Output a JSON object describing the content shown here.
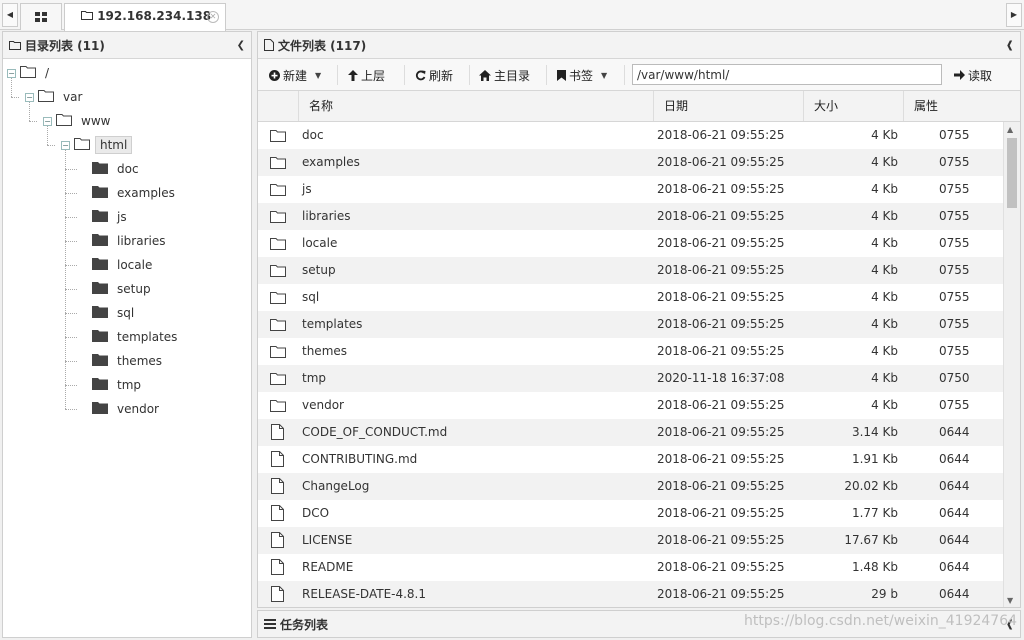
{
  "tabs": {
    "active_label": "192.168.234.138"
  },
  "dir_panel": {
    "title": "目录列表 (11)",
    "tree": [
      {
        "label": "/",
        "level": 0,
        "kind": "expanded"
      },
      {
        "label": "var",
        "level": 1,
        "kind": "expanded"
      },
      {
        "label": "www",
        "level": 2,
        "kind": "expanded"
      },
      {
        "label": "html",
        "level": 3,
        "kind": "expanded",
        "selected": true
      },
      {
        "label": "doc",
        "level": 4,
        "kind": "leaf"
      },
      {
        "label": "examples",
        "level": 4,
        "kind": "leaf"
      },
      {
        "label": "js",
        "level": 4,
        "kind": "leaf"
      },
      {
        "label": "libraries",
        "level": 4,
        "kind": "leaf"
      },
      {
        "label": "locale",
        "level": 4,
        "kind": "leaf"
      },
      {
        "label": "setup",
        "level": 4,
        "kind": "leaf"
      },
      {
        "label": "sql",
        "level": 4,
        "kind": "leaf"
      },
      {
        "label": "templates",
        "level": 4,
        "kind": "leaf"
      },
      {
        "label": "themes",
        "level": 4,
        "kind": "leaf"
      },
      {
        "label": "tmp",
        "level": 4,
        "kind": "leaf"
      },
      {
        "label": "vendor",
        "level": 4,
        "kind": "leaf"
      }
    ]
  },
  "file_panel": {
    "title": "文件列表 (117)",
    "toolbar": {
      "new_label": "新建",
      "up_label": "上层",
      "refresh_label": "刷新",
      "home_label": "主目录",
      "bookmark_label": "书签",
      "path_value": "/var/www/html/",
      "read_label": "读取"
    },
    "columns": {
      "name": "名称",
      "date": "日期",
      "size": "大小",
      "attr": "属性"
    },
    "rows": [
      {
        "type": "folder",
        "name": "doc",
        "date": "2018-06-21 09:55:25",
        "size": "4 Kb",
        "attr": "0755"
      },
      {
        "type": "folder",
        "name": "examples",
        "date": "2018-06-21 09:55:25",
        "size": "4 Kb",
        "attr": "0755"
      },
      {
        "type": "folder",
        "name": "js",
        "date": "2018-06-21 09:55:25",
        "size": "4 Kb",
        "attr": "0755"
      },
      {
        "type": "folder",
        "name": "libraries",
        "date": "2018-06-21 09:55:25",
        "size": "4 Kb",
        "attr": "0755"
      },
      {
        "type": "folder",
        "name": "locale",
        "date": "2018-06-21 09:55:25",
        "size": "4 Kb",
        "attr": "0755"
      },
      {
        "type": "folder",
        "name": "setup",
        "date": "2018-06-21 09:55:25",
        "size": "4 Kb",
        "attr": "0755"
      },
      {
        "type": "folder",
        "name": "sql",
        "date": "2018-06-21 09:55:25",
        "size": "4 Kb",
        "attr": "0755"
      },
      {
        "type": "folder",
        "name": "templates",
        "date": "2018-06-21 09:55:25",
        "size": "4 Kb",
        "attr": "0755"
      },
      {
        "type": "folder",
        "name": "themes",
        "date": "2018-06-21 09:55:25",
        "size": "4 Kb",
        "attr": "0755"
      },
      {
        "type": "folder",
        "name": "tmp",
        "date": "2020-11-18 16:37:08",
        "size": "4 Kb",
        "attr": "0750"
      },
      {
        "type": "folder",
        "name": "vendor",
        "date": "2018-06-21 09:55:25",
        "size": "4 Kb",
        "attr": "0755"
      },
      {
        "type": "file",
        "name": "CODE_OF_CONDUCT.md",
        "date": "2018-06-21 09:55:25",
        "size": "3.14 Kb",
        "attr": "0644"
      },
      {
        "type": "file",
        "name": "CONTRIBUTING.md",
        "date": "2018-06-21 09:55:25",
        "size": "1.91 Kb",
        "attr": "0644"
      },
      {
        "type": "file",
        "name": "ChangeLog",
        "date": "2018-06-21 09:55:25",
        "size": "20.02 Kb",
        "attr": "0644"
      },
      {
        "type": "file",
        "name": "DCO",
        "date": "2018-06-21 09:55:25",
        "size": "1.77 Kb",
        "attr": "0644"
      },
      {
        "type": "file",
        "name": "LICENSE",
        "date": "2018-06-21 09:55:25",
        "size": "17.67 Kb",
        "attr": "0644"
      },
      {
        "type": "file",
        "name": "README",
        "date": "2018-06-21 09:55:25",
        "size": "1.48 Kb",
        "attr": "0644"
      },
      {
        "type": "file",
        "name": "RELEASE-DATE-4.8.1",
        "date": "2018-06-21 09:55:25",
        "size": "29 b",
        "attr": "0644"
      }
    ]
  },
  "task_panel": {
    "title": "任务列表"
  },
  "watermark": "https://blog.csdn.net/weixin_41924764"
}
